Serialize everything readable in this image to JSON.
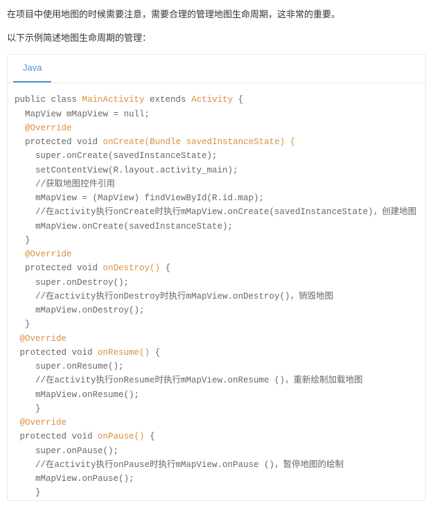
{
  "intro": {
    "p1": "在项目中使用地图的时候需要注意，需要合理的管理地图生命周期，这非常的重要。",
    "p2": "以下示例简述地图生命周期的管理："
  },
  "tab_label": "Java",
  "code": {
    "l01a": "public",
    "l01b": " class ",
    "l01c": "MainActivity",
    "l01d": " extends ",
    "l01e": "Activity",
    "l01f": " {",
    "l02": "  MapView mMapView = null;",
    "l03": "  @Override",
    "l04a": "  protected void ",
    "l04b": "onCreate",
    "l04c": "(",
    "l04d": "Bundle savedInstanceState",
    "l04e": ") {",
    "l05": "    super.onCreate(savedInstanceState);",
    "l06": "    setContentView(R.layout.activity_main);",
    "l07": "    //获取地图控件引用",
    "l08": "    mMapView = (MapView) findViewById(R.id.map);",
    "l09": "    //在activity执行onCreate时执行mMapView.onCreate(savedInstanceState)，创建地图",
    "l10": "    mMapView.onCreate(savedInstanceState);",
    "l11": "  }",
    "l12": "  @Override",
    "l13a": "  protected void ",
    "l13b": "onDestroy",
    "l13c": "()",
    "l13d": " {",
    "l14": "    super.onDestroy();",
    "l15": "    //在activity执行onDestroy时执行mMapView.onDestroy()，销毁地图",
    "l16": "    mMapView.onDestroy();",
    "l17": "  }",
    "l18": " @Override",
    "l19a": " protected void ",
    "l19b": "onResume",
    "l19c": "()",
    "l19d": " {",
    "l20": "    super.onResume();",
    "l21": "    //在activity执行onResume时执行mMapView.onResume ()，重新绘制加载地图",
    "l22": "    mMapView.onResume();",
    "l23": "    }",
    "l24": " @Override",
    "l25a": " protected void ",
    "l25b": "onPause",
    "l25c": "()",
    "l25d": " {",
    "l26": "    super.onPause();",
    "l27": "    //在activity执行onPause时执行mMapView.onPause ()，暂停地图的绘制",
    "l28": "    mMapView.onPause();",
    "l29": "    }"
  }
}
